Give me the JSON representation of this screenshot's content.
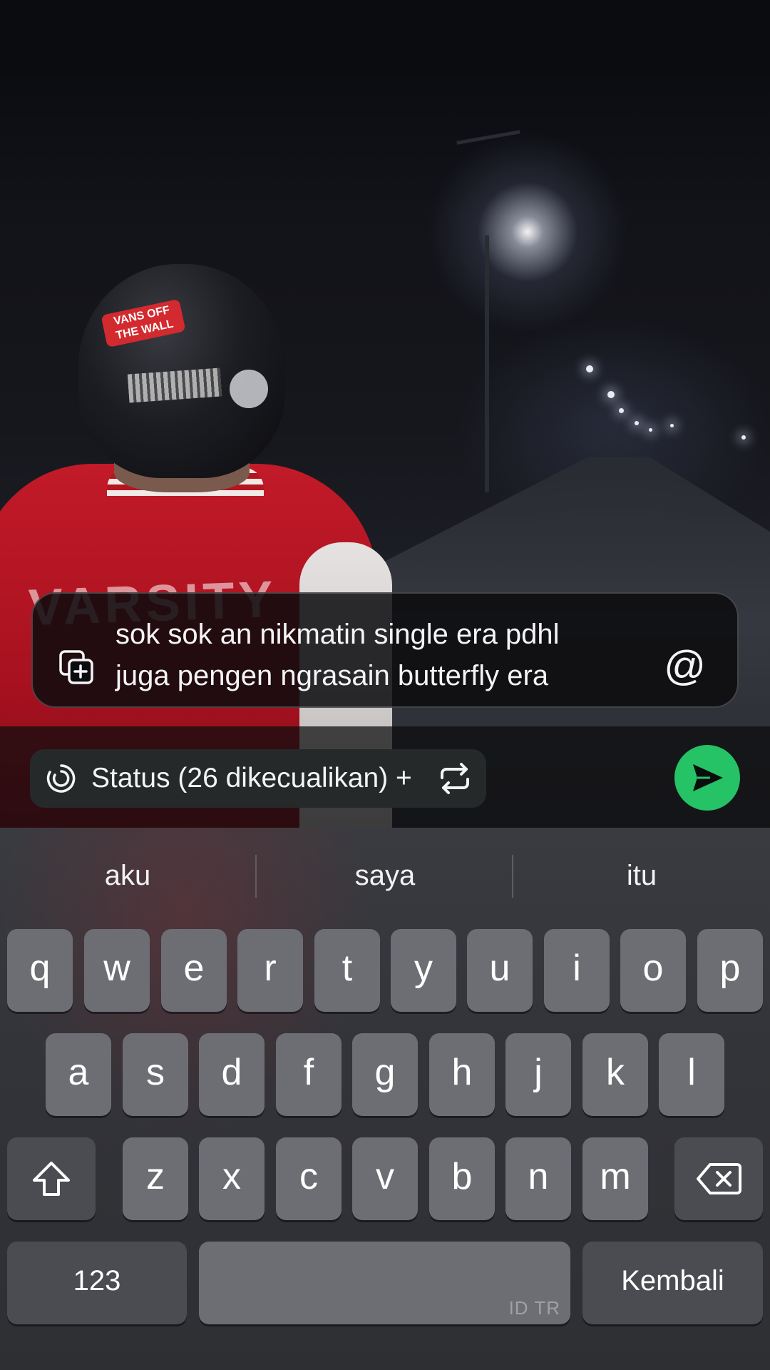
{
  "photo": {
    "sticker_text": "VANS OFF THE WALL",
    "jacket_text": "VARSITY"
  },
  "caption": {
    "lines": [
      "sok sok an nikmatin single era pdhl",
      "juga pengen ngrasain butterfly era"
    ],
    "icons": {
      "left": "add-media-icon",
      "right": "mention-icon"
    },
    "mention_symbol": "@"
  },
  "audience": {
    "label": "Status (26 dikecualikan) +",
    "icons": {
      "left": "status-ring-icon",
      "right": "repeat-icon"
    }
  },
  "send": {
    "icon": "send-arrow-icon",
    "color": "#25c266"
  },
  "keyboard": {
    "suggestions": [
      "aku",
      "saya",
      "itu"
    ],
    "row1": [
      "q",
      "w",
      "e",
      "r",
      "t",
      "y",
      "u",
      "i",
      "o",
      "p"
    ],
    "row2": [
      "a",
      "s",
      "d",
      "f",
      "g",
      "h",
      "j",
      "k",
      "l"
    ],
    "row3": [
      "z",
      "x",
      "c",
      "v",
      "b",
      "n",
      "m"
    ],
    "shift_icon": "shift-icon",
    "backspace_icon": "backspace-icon",
    "numbers_label": "123",
    "space_watermark": "ID TR",
    "return_label": "Kembali"
  }
}
